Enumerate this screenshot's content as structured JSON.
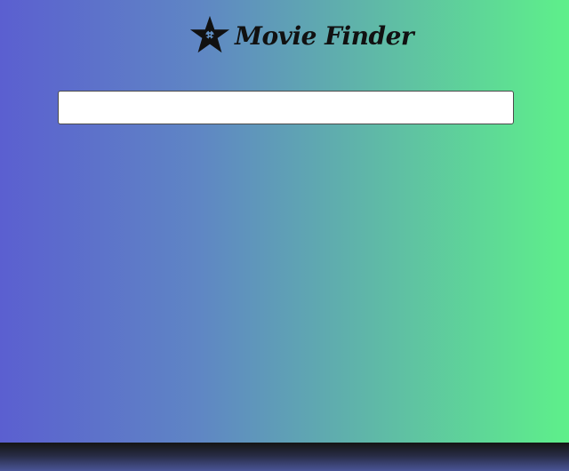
{
  "app": {
    "title": "Movie Finder",
    "logo_icon": "film-star-icon"
  },
  "search": {
    "value": "",
    "placeholder": ""
  },
  "colors": {
    "gradient_start": "#5b5fd0",
    "gradient_end": "#5ef08a",
    "title_text": "#111111"
  }
}
